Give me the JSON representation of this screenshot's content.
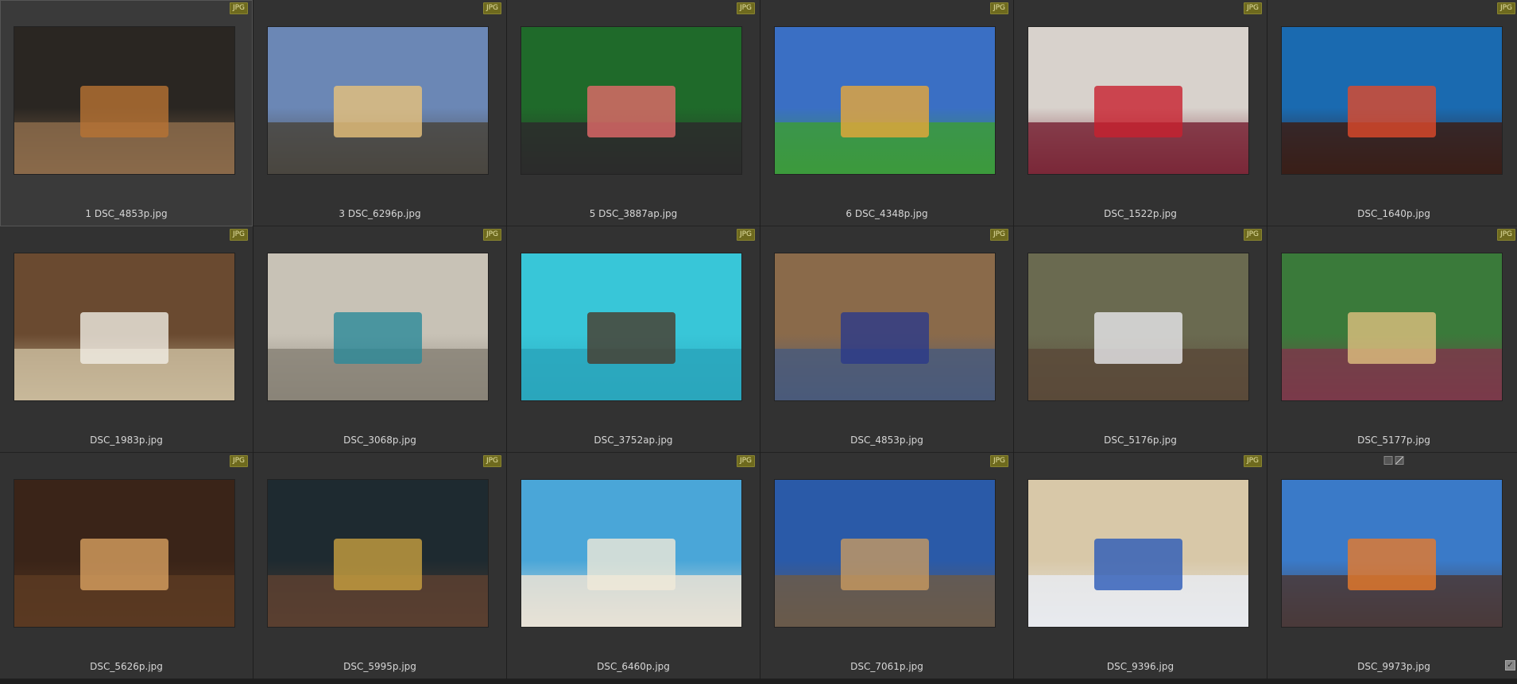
{
  "file_type_badge": "JPG",
  "thumbnails": [
    {
      "file": "1 DSC_4853p.jpg",
      "sky": "#2a2622",
      "floor": "#8a6a4a",
      "accent": "#b87333"
    },
    {
      "file": "3 DSC_6296p.jpg",
      "sky": "#6b87b5",
      "floor": "#4a4640",
      "accent": "#e8c27a"
    },
    {
      "file": "5 DSC_3887ap.jpg",
      "sky": "#1f6a2a",
      "floor": "#2c2c2c",
      "accent": "#e36a6a"
    },
    {
      "file": "6 DSC_4348p.jpg",
      "sky": "#3a6fc4",
      "floor": "#3c9a3c",
      "accent": "#e8a83a"
    },
    {
      "file": "DSC_1522p.jpg",
      "sky": "#d8d2cc",
      "floor": "#7a2838",
      "accent": "#c8202e"
    },
    {
      "file": "DSC_1640p.jpg",
      "sky": "#1a6ab0",
      "floor": "#3a1e18",
      "accent": "#e04a2a"
    },
    {
      "file": "DSC_1983p.jpg",
      "sky": "#6a4a30",
      "floor": "#c8b89a",
      "accent": "#f0ece4"
    },
    {
      "file": "DSC_3068p.jpg",
      "sky": "#c8c2b6",
      "floor": "#8a8478",
      "accent": "#2a8a9a"
    },
    {
      "file": "DSC_3752ap.jpg",
      "sky": "#38c6d8",
      "floor": "#2aa6bc",
      "accent": "#4a3a2a"
    },
    {
      "file": "DSC_4853p.jpg",
      "sky": "#8a6a4a",
      "floor": "#4a5a7a",
      "accent": "#2a3a8a"
    },
    {
      "file": "DSC_5176p.jpg",
      "sky": "#6a6a50",
      "floor": "#5a4a3a",
      "accent": "#e8e8ec"
    },
    {
      "file": "DSC_5177p.jpg",
      "sky": "#3a7a3a",
      "floor": "#7a3a4a",
      "accent": "#e0c080"
    },
    {
      "file": "DSC_5626p.jpg",
      "sky": "#3a2418",
      "floor": "#5a3a22",
      "accent": "#d8a060"
    },
    {
      "file": "DSC_5995p.jpg",
      "sky": "#1e2a30",
      "floor": "#5a4030",
      "accent": "#c8a040"
    },
    {
      "file": "DSC_6460p.jpg",
      "sky": "#4aa6d8",
      "floor": "#e8e2d6",
      "accent": "#f0ead8"
    },
    {
      "file": "DSC_7061p.jpg",
      "sky": "#2a5aa8",
      "floor": "#6a5a4a",
      "accent": "#c89a60"
    },
    {
      "file": "DSC_9396.jpg",
      "sky": "#d8c8a8",
      "floor": "#e8eaee",
      "accent": "#2a5ab8"
    },
    {
      "file": "DSC_9973p.jpg",
      "sky": "#3a7ac8",
      "floor": "#4a3a3a",
      "accent": "#e87a2a"
    }
  ]
}
